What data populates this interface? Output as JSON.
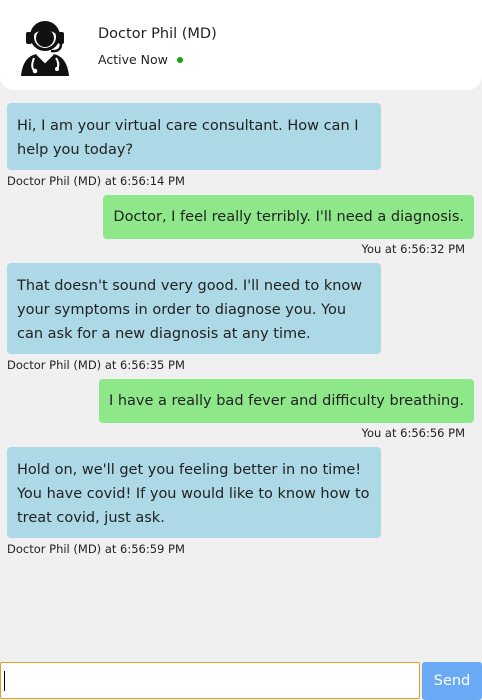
{
  "header": {
    "name": "Doctor Phil (MD)",
    "status": "Active Now",
    "status_color": "#12a312",
    "avatar_icon": "doctor-headset-icon"
  },
  "messages": [
    {
      "sender": "doctor",
      "text": "Hi, I am your virtual care consultant. How can I help you today?",
      "meta": "Doctor Phil (MD) at 6:56:14 PM"
    },
    {
      "sender": "user",
      "text": "Doctor, I feel really terribly. I'll need a diagnosis.",
      "meta": "You at 6:56:32 PM"
    },
    {
      "sender": "doctor",
      "text": "That doesn't sound very good. I'll need to know your symptoms in order to diagnose you. You can ask for a new diagnosis at any time.",
      "meta": "Doctor Phil (MD) at 6:56:35 PM"
    },
    {
      "sender": "user",
      "text": "I have a really bad fever and difficulty breathing.",
      "meta": "You at 6:56:56 PM"
    },
    {
      "sender": "doctor",
      "text": "Hold on, we'll get you feeling better in no time! You have covid! If you would like to know how to treat covid, just ask.",
      "meta": "Doctor Phil (MD) at 6:56:59 PM"
    }
  ],
  "composer": {
    "value": "",
    "placeholder": "",
    "send_label": "Send"
  },
  "colors": {
    "doctor_bubble": "#add8e6",
    "user_bubble": "#8ee88a",
    "send_button": "#6aa9f4",
    "input_border": "#e1a026"
  }
}
